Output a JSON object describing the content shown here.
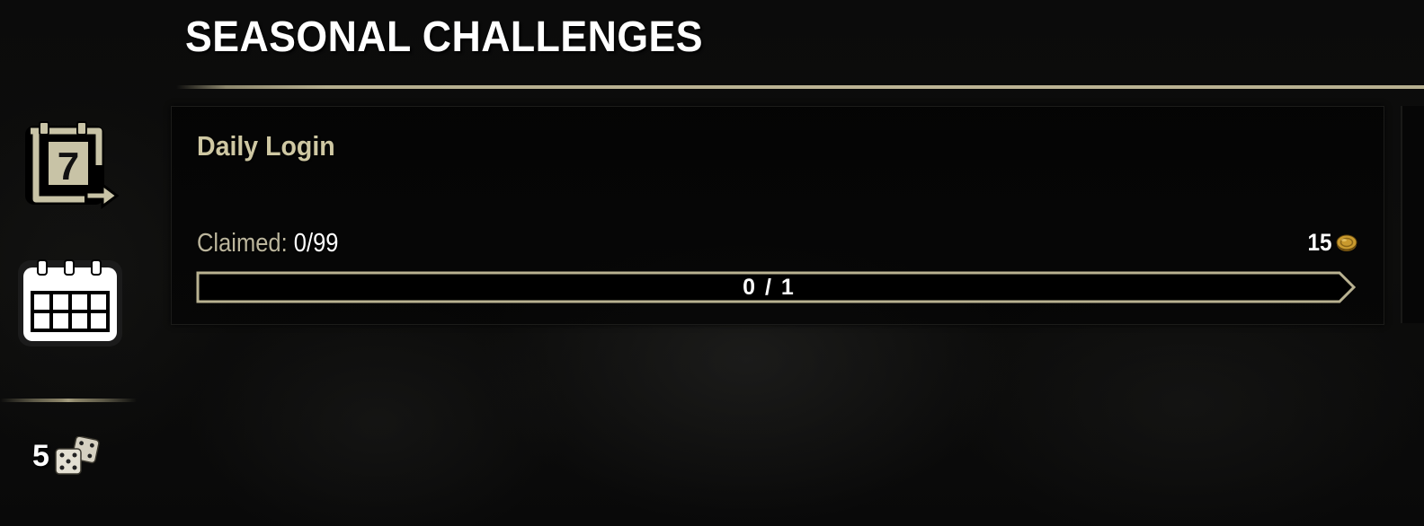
{
  "header": {
    "title": "SEASONAL CHALLENGES"
  },
  "sidebar": {
    "items": [
      {
        "id": "daily-login",
        "icon": "calendar-seven-icon",
        "badge": "7"
      },
      {
        "id": "calendar",
        "icon": "calendar-grid-icon"
      }
    ],
    "tickets": {
      "count": "5",
      "icon": "dice-icon"
    }
  },
  "challenge": {
    "title": "Daily Login",
    "claimed_label": "Claimed:",
    "claimed_value": "0/99",
    "reward_amount": "15",
    "reward_icon": "gold-coin-icon",
    "progress_text": "0 / 1",
    "progress_fraction": 0
  },
  "colors": {
    "accent": "#bdb595",
    "title_gold": "#cfc8a3",
    "coin": "#c99a2e"
  }
}
